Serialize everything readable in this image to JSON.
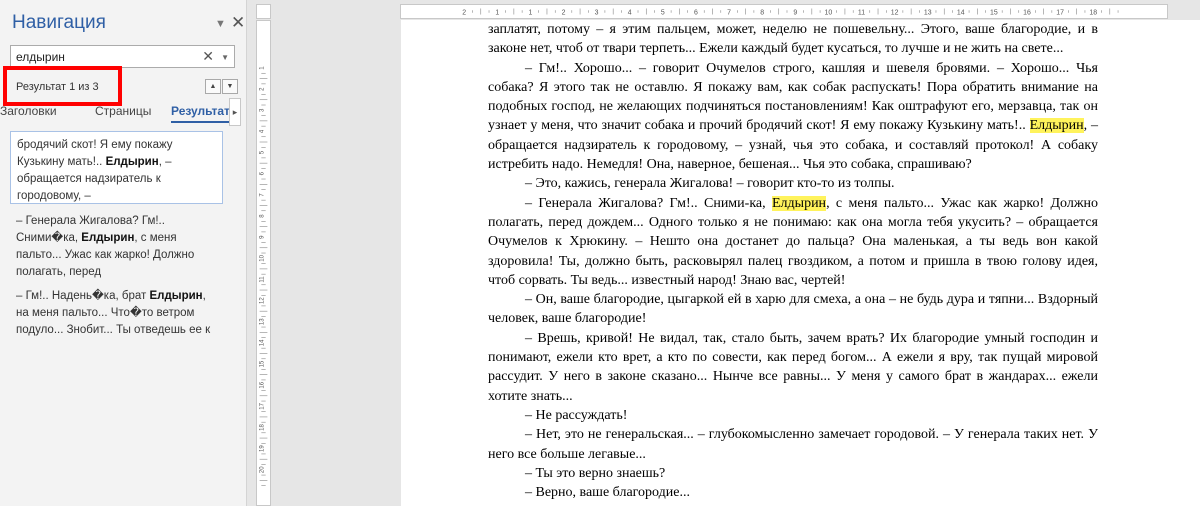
{
  "navigation": {
    "title": "Навигация",
    "search_value": "елдырин",
    "result_counter": "Результат 1 из 3",
    "tabs": [
      "Заголовки",
      "Страницы",
      "Результаты"
    ],
    "results": [
      {
        "before": "бродячий скот! Я ему покажу Кузькину мать!.. ",
        "match": "Елдырин",
        "after": ", – обращается надзиратель к городовому, –"
      },
      {
        "before": "– Генерала Жигалова? Гм!.. Сними�ка, ",
        "match": "Елдырин",
        "after": ", с меня пальто... Ужас как жарко! Должно полагать, перед"
      },
      {
        "before": "– Гм!.. Надень�ка, брат ",
        "match": "Елдырин",
        "after": ", на меня пальто... Что�то ветром подуло... Знобит... Ты отведешь ее к"
      }
    ]
  },
  "document": {
    "paragraphs": [
      {
        "indent": false,
        "text": "заплатят, потому – я этим пальцем, может, неделю не пошевельну... Этого, ваше благородие, и в законе нет, чтоб от твари терпеть... Ежели каждый будет кусаться, то лучше и не жить на свете..."
      },
      {
        "indent": true,
        "text": "– Гм!.. Хорошо... – говорит Очумелов строго, кашляя и шевеля бровями. – Хорошо... Чья собака? Я этого так не оставлю. Я покажу вам, как собак распускать! Пора обратить внимание на подобных господ, не желающих подчиняться постановлениям! Как оштрафуют его, мерзавца, так он узнает у меня, что значит собака и прочий бродячий скот! Я ему покажу Кузькину мать!.. ",
        "match": "Елдырин",
        "after": ", – обращается надзиратель к городовому, – узнай, чья это собака, и составляй протокол! А собаку истребить надо. Немедля! Она, наверное, бешеная... Чья это собака, спрашиваю?"
      },
      {
        "indent": true,
        "text": "– Это, кажись, генерала Жигалова! – говорит кто-то из толпы."
      },
      {
        "indent": true,
        "text": "– Генерала Жигалова? Гм!.. Сними-ка, ",
        "match": "Елдырин",
        "after": ", с меня пальто... Ужас как жарко! Должно полагать, перед дождем... Одного только я не понимаю: как она могла тебя укусить? – обращается Очумелов к Хрюкину. – Нешто она достанет до пальца? Она маленькая, а ты ведь вон какой здоровила! Ты, должно быть, расковырял палец гвоздиком, а потом и пришла в твою голову идея, чтоб сорвать. Ты ведь... известный народ! Знаю вас, чертей!"
      },
      {
        "indent": true,
        "text": "– Он, ваше благородие, цыгаркой ей в харю для смеха, а она – не будь дура и тяпни... Вздорный человек, ваше благородие!"
      },
      {
        "indent": true,
        "text": "– Врешь, кривой! Не видал, так, стало быть, зачем врать? Их благородие умный господин и понимают, ежели кто врет, а кто по совести, как перед богом... А ежели я вру, так пущай мировой рассудит. У него в законе сказано... Нынче все равны... У меня у самого брат в жандарах... ежели хотите знать..."
      },
      {
        "indent": true,
        "text": "– Не рассуждать!"
      },
      {
        "indent": true,
        "text": "– Нет, это не генеральская... – глубокомысленно замечает городовой. – У генерала таких нет. У него все больше легавые..."
      },
      {
        "indent": true,
        "text": "– Ты это верно знаешь?"
      },
      {
        "indent": true,
        "text": "– Верно, ваше благородие..."
      }
    ]
  },
  "ruler_numbers": [
    "2",
    "1",
    "1",
    "2",
    "3",
    "4",
    "5",
    "6",
    "7",
    "8",
    "9",
    "10",
    "11",
    "12",
    "13",
    "14",
    "15",
    "16",
    "17",
    "18"
  ],
  "vruler_numbers": [
    "1",
    "2",
    "3",
    "4",
    "5",
    "6",
    "7",
    "8",
    "9",
    "10",
    "11",
    "12",
    "13",
    "14",
    "15",
    "16",
    "17",
    "18",
    "19",
    "20"
  ],
  "icons": [
    "dropdown-arrow-icon",
    "close-icon",
    "clear-search-icon",
    "search-options-icon",
    "up-arrow-icon",
    "down-arrow-icon",
    "more-tabs-icon"
  ],
  "colors": {
    "accent": "#2f5fa5",
    "highlight": "#fff35c",
    "red_annotation": "#ff0000"
  }
}
